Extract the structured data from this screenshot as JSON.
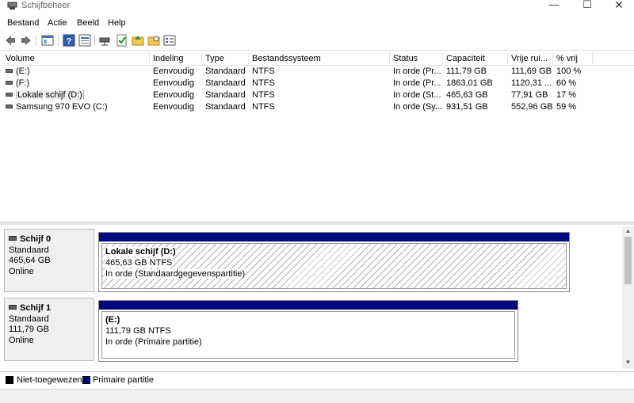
{
  "window": {
    "title": "Schijfbeheer",
    "minimize_glyph": "—",
    "maximize_glyph": "☐",
    "close_glyph": "✕"
  },
  "menu": [
    "Bestand",
    "Actie",
    "Beeld",
    "Help"
  ],
  "toolbar": {
    "icons": [
      "back-icon",
      "forward-icon",
      "console-tree-icon",
      "help-icon",
      "properties-icon",
      "connect-icon",
      "check-icon",
      "up-folder-icon",
      "rescan-icon",
      "settings-icon"
    ]
  },
  "volume_list": {
    "columns": [
      "Volume",
      "Indeling",
      "Type",
      "Bestandssysteem",
      "Status",
      "Capaciteit",
      "Vrije rui...",
      "% vrij"
    ],
    "rows": [
      {
        "volume": "(E:)",
        "layout": "Eenvoudig",
        "type": "Standaard",
        "fs": "NTFS",
        "status": "In orde (Pr...",
        "capacity": "111,79 GB",
        "free": "111,69 GB",
        "pct": "100 %"
      },
      {
        "volume": "(F:)",
        "layout": "Eenvoudig",
        "type": "Standaard",
        "fs": "NTFS",
        "status": "In orde (Pr...",
        "capacity": "1863,01 GB",
        "free": "1120,31 ...",
        "pct": "60 %"
      },
      {
        "volume": "Lokale schijf (D:)",
        "layout": "Eenvoudig",
        "type": "Standaard",
        "fs": "NTFS",
        "status": "In orde (St...",
        "capacity": "465,63 GB",
        "free": "77,91 GB",
        "pct": "17 %"
      },
      {
        "volume": "Samsung 970 EVO (C:)",
        "layout": "Eenvoudig",
        "type": "Standaard",
        "fs": "NTFS",
        "status": "In orde (Sy...",
        "capacity": "931,51 GB",
        "free": "552,96 GB",
        "pct": "59 %"
      }
    ]
  },
  "disks": [
    {
      "name": "Schijf 0",
      "kind": "Standaard",
      "size": "465,64 GB",
      "state": "Online",
      "partition": {
        "title": "Lokale schijf  (D:)",
        "size_fs": "465,63 GB NTFS",
        "status": "In orde (Standaardgegevenspartitie)"
      }
    },
    {
      "name": "Schijf 1",
      "kind": "Standaard",
      "size": "111,79 GB",
      "state": "Online",
      "partition": {
        "title": "(E:)",
        "size_fs": "111,79 GB NTFS",
        "status": "In orde (Primaire partitie)"
      }
    }
  ],
  "legend": [
    {
      "label": "Niet-toegewezen",
      "color": "#000000"
    },
    {
      "label": "Primaire partitie",
      "color": "#00087d"
    }
  ]
}
